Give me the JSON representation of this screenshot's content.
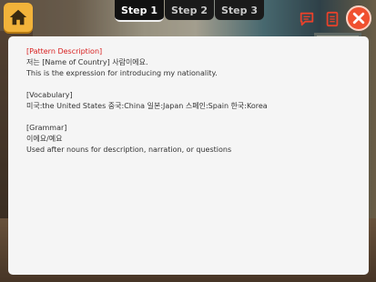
{
  "colors": {
    "home_button": "#f2b33a",
    "close_button": "#f0502f",
    "icon_red": "#e8412b",
    "description_title": "#d81e1e",
    "tab_bg": "#1a1a1a"
  },
  "icons": {
    "home": "home-icon",
    "chat": "chat-bubble-icon",
    "list": "document-list-icon",
    "close": "close-x-icon"
  },
  "tabs": [
    {
      "label": "Step 1",
      "active": true
    },
    {
      "label": "Step 2",
      "active": false
    },
    {
      "label": "Step 3",
      "active": false
    }
  ],
  "panel": {
    "pattern": {
      "title": "[Pattern Description]",
      "line1": "저는 [Name of Country] 사람이에요.",
      "line2": "This is the expression for introducing my nationality."
    },
    "vocabulary": {
      "title": "[Vocabulary]",
      "line1": "미국:the United States 중국:China 일본:Japan 스페인:Spain 한국:Korea"
    },
    "grammar": {
      "title": "[Grammar]",
      "line1": "이에요/예요",
      "line2": "Used after nouns for description, narration, or questions"
    }
  }
}
